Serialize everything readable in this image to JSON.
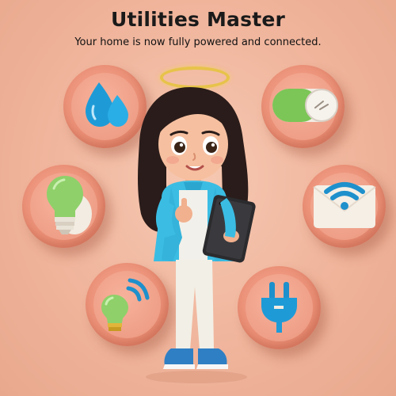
{
  "title": "Utilities Master",
  "subtitle": "Your home is now fully powered and connected.",
  "icons": [
    {
      "name": "water-drops-icon"
    },
    {
      "name": "toggle-switch-icon"
    },
    {
      "name": "light-bulb-icon"
    },
    {
      "name": "wifi-mail-icon"
    },
    {
      "name": "smart-bulb-icon"
    },
    {
      "name": "electric-plug-icon"
    }
  ],
  "colors": {
    "background": "#f0b59c",
    "badge": "#ea8f76",
    "water": "#1e9bd7",
    "green": "#7cc557",
    "shirt": "#3bbde3",
    "halo": "#e7c34a"
  }
}
